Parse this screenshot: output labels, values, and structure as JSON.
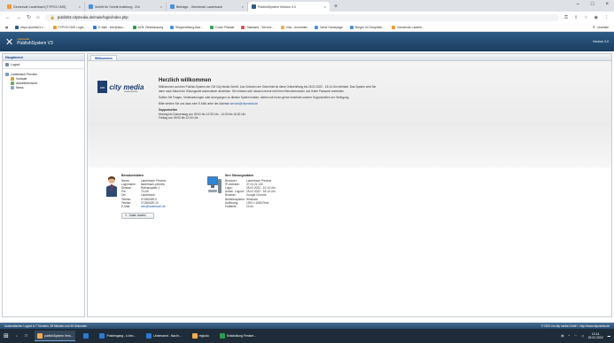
{
  "browser": {
    "tabs": [
      {
        "label": "Gemeinde Lauterbach [TYPO3 CMS]",
        "color": "#f29a2b"
      },
      {
        "label": "Schritt für Schritt Anleitung - Ein",
        "color": "#4a90d9"
      },
      {
        "label": "Beiträge - Gemeinde Lauterbach",
        "color": "#4a90d9"
      },
      {
        "label": "PublishSystem Version 3.0",
        "color": "#2e5b86",
        "active": true
      }
    ],
    "new_tab": "+",
    "window_controls": [
      "–",
      "□",
      "×"
    ],
    "url": "publish3.citymedia.de/main/login/index.php",
    "bookmarks": [
      {
        "label": "https://publish3.c...",
        "color": "#2e5b86"
      },
      {
        "label": "TYPO3 CMS Login...",
        "color": "#f29a2b"
      },
      {
        "label": "E-Mail - info@lauc...",
        "color": "#2a7bd3"
      },
      {
        "label": "AOK Zielerfassung",
        "color": "#2a9d4a"
      },
      {
        "label": "Bürgerstiftung Bae...",
        "color": "#4a90d9"
      },
      {
        "label": "Cover Plakate",
        "color": "#34a853"
      },
      {
        "label": "Starbaria - Service...",
        "color": "#d9534f"
      },
      {
        "label": "Kita - Anmelden",
        "color": "#f0ad4e"
      },
      {
        "label": "Neue Homepage",
        "color": "#4a90d9"
      },
      {
        "label": "Bürger im Gespräch...",
        "color": "#4a90d9"
      },
      {
        "label": "Gemeinde Lauterb...",
        "color": "#f29a2b"
      }
    ],
    "reading_list": "Leseliste"
  },
  "app": {
    "brand_top": "citymedia",
    "name": "PublishSystem V3",
    "version": "Version 3.0"
  },
  "sidebar": {
    "title": "Hauptmenü",
    "logout": "Logout",
    "tree": [
      {
        "label": "Lauterbach Preview",
        "level": 0,
        "color": "#7a9cc6"
      },
      {
        "label": "Vorlaute",
        "level": 1,
        "color": "#d9a13a"
      },
      {
        "label": "Aktuellübersicht",
        "level": 1,
        "color": "#6fa85c"
      },
      {
        "label": "News",
        "level": 1,
        "color": "#8aa9c9"
      }
    ]
  },
  "main": {
    "tab": "Willkommen",
    "logo_short": "cm",
    "logo_text": "city media",
    "logo_sub": "mediendienste",
    "welcome": {
      "title": "Herzlich willkommen",
      "p1": "Willkommen auf dem Publish-System der CM City Media GmbH. Aus Gründen der Sicherheit ist diese Onlinehilfung bis 25.02.2022 - 18:14 Uhr befristet. Das System wird Sie dann nach Ablauf der Sitzungszeit automatisch abmelden. Sie müssen sich danach erneut mit Ihrem Benutzernamen und Ihrem Passwort anmelden.",
      "p2": "Sollten Sie Fragen, Verbesserungen oder Anregungen zu diesem System haben, stehen wir Ihnen gerne innerhalb unserer Supportzeiten zur Verfügung.",
      "p3_prefix": "Bitte senden Sie uns dazu eine E-Mail unter der Adresse",
      "p3_link": "service@citymedia.de",
      "support_title": "Supportzeiten",
      "support_1": "Montag bis Donnerstag von 09:00 bis 12:30 Uhr - 14:00 bis 16:30 Uhr",
      "support_2": "Freitag von 09:00 bis 12:00 Uhr"
    },
    "user": {
      "title": "Benutzerdaten",
      "rows": [
        {
          "k": "Name:",
          "v": "Lauterbach Preview"
        },
        {
          "k": "Loginname:",
          "v": "lauterbach-preview"
        },
        {
          "k": "Strasse:",
          "v": "Rathausplatz 1"
        },
        {
          "k": "Plz:",
          "v": "71149"
        },
        {
          "k": "Ort:",
          "v": "Lauterbach"
        },
        {
          "k": "Telefon:",
          "v": "07185/189-0"
        },
        {
          "k": "Telefax:",
          "v": "07185/189-10"
        },
        {
          "k": "E-Mail:",
          "v": "info@lauterbach.de",
          "link": true
        }
      ],
      "edit_button": "Daten ändern"
    },
    "session": {
      "title": "Ihre Sitzungsdaten",
      "rows": [
        {
          "k": "Benutzer:",
          "v": "Lauterbach Preview"
        },
        {
          "k": "IP-Adresse:",
          "v": "37.24.21.130"
        },
        {
          "k": "Login:",
          "v": "25.02.2022 - 10:14 Uhr"
        },
        {
          "k": "Autom. Logout:",
          "v": "25.02.2022 - 18:14 Uhr"
        },
        {
          "k": "Browser:",
          "v": "Google Chrome"
        },
        {
          "k": "Betriebssystem:",
          "v": "Windows"
        },
        {
          "k": "Auflösung:",
          "v": "1920 x 1080 Pixel"
        },
        {
          "k": "Farbtiefe:",
          "v": "24 bit"
        }
      ]
    }
  },
  "statusbar": {
    "left": "Automatischer Logout in 7 Stunden, 59 Minuten und 46 Sekunden",
    "right": "© 2022 cm city media GmbH - http://www.citymedia.de"
  },
  "taskbar": {
    "items": [
      {
        "label": "publishSystem Vers...",
        "color": "#f0ad4e",
        "active": true
      },
      {
        "label": "",
        "color": "#2a7bd3"
      },
      {
        "label": "Posteingang - k.bec...",
        "color": "#2a7bd3"
      },
      {
        "label": "Unbenannt - Nachr...",
        "color": "#2a7bd3"
      },
      {
        "label": "regiodo",
        "color": "#f0ad4e"
      },
      {
        "label": "Entwicklung Fenster...",
        "color": "#2a9d4a"
      }
    ],
    "time": "10:14",
    "date": "25.02.2022"
  }
}
